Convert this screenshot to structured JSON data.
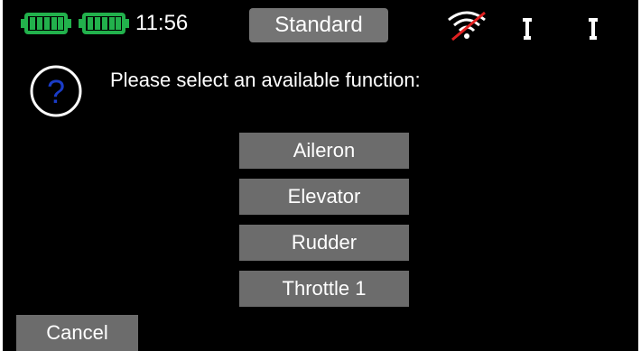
{
  "status_bar": {
    "time": "11:56",
    "mode_label": "Standard",
    "battery_color": "#22b14c",
    "wifi_icon": "wifi-disabled-icon",
    "antenna_icon": "antenna-icon"
  },
  "dialog": {
    "icon": "question-icon",
    "icon_color": "#1a3cc8",
    "prompt": "Please select an available function:",
    "options": [
      {
        "label": "Aileron"
      },
      {
        "label": "Elevator"
      },
      {
        "label": "Rudder"
      },
      {
        "label": "Throttle 1"
      }
    ],
    "cancel_label": "Cancel"
  }
}
